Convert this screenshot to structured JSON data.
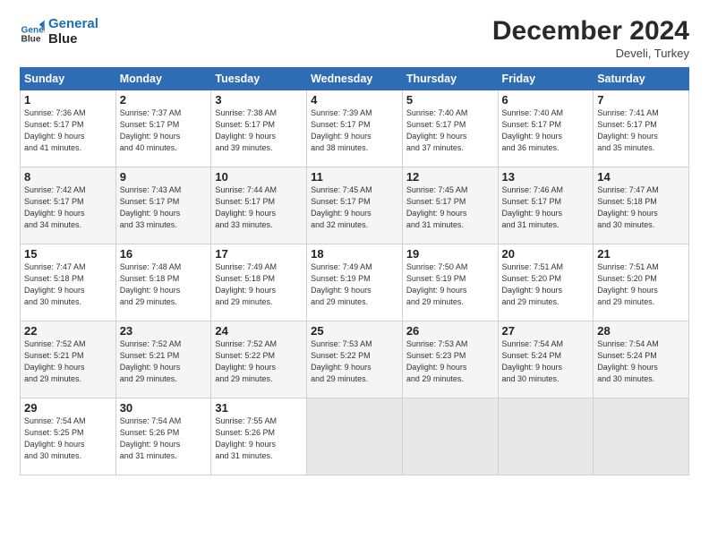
{
  "logo": {
    "line1": "General",
    "line2": "Blue"
  },
  "title": "December 2024",
  "location": "Develi, Turkey",
  "days_of_week": [
    "Sunday",
    "Monday",
    "Tuesday",
    "Wednesday",
    "Thursday",
    "Friday",
    "Saturday"
  ],
  "weeks": [
    [
      {
        "day": "1",
        "info": "Sunrise: 7:36 AM\nSunset: 5:17 PM\nDaylight: 9 hours\nand 41 minutes."
      },
      {
        "day": "2",
        "info": "Sunrise: 7:37 AM\nSunset: 5:17 PM\nDaylight: 9 hours\nand 40 minutes."
      },
      {
        "day": "3",
        "info": "Sunrise: 7:38 AM\nSunset: 5:17 PM\nDaylight: 9 hours\nand 39 minutes."
      },
      {
        "day": "4",
        "info": "Sunrise: 7:39 AM\nSunset: 5:17 PM\nDaylight: 9 hours\nand 38 minutes."
      },
      {
        "day": "5",
        "info": "Sunrise: 7:40 AM\nSunset: 5:17 PM\nDaylight: 9 hours\nand 37 minutes."
      },
      {
        "day": "6",
        "info": "Sunrise: 7:40 AM\nSunset: 5:17 PM\nDaylight: 9 hours\nand 36 minutes."
      },
      {
        "day": "7",
        "info": "Sunrise: 7:41 AM\nSunset: 5:17 PM\nDaylight: 9 hours\nand 35 minutes."
      }
    ],
    [
      {
        "day": "8",
        "info": "Sunrise: 7:42 AM\nSunset: 5:17 PM\nDaylight: 9 hours\nand 34 minutes."
      },
      {
        "day": "9",
        "info": "Sunrise: 7:43 AM\nSunset: 5:17 PM\nDaylight: 9 hours\nand 33 minutes."
      },
      {
        "day": "10",
        "info": "Sunrise: 7:44 AM\nSunset: 5:17 PM\nDaylight: 9 hours\nand 33 minutes."
      },
      {
        "day": "11",
        "info": "Sunrise: 7:45 AM\nSunset: 5:17 PM\nDaylight: 9 hours\nand 32 minutes."
      },
      {
        "day": "12",
        "info": "Sunrise: 7:45 AM\nSunset: 5:17 PM\nDaylight: 9 hours\nand 31 minutes."
      },
      {
        "day": "13",
        "info": "Sunrise: 7:46 AM\nSunset: 5:17 PM\nDaylight: 9 hours\nand 31 minutes."
      },
      {
        "day": "14",
        "info": "Sunrise: 7:47 AM\nSunset: 5:18 PM\nDaylight: 9 hours\nand 30 minutes."
      }
    ],
    [
      {
        "day": "15",
        "info": "Sunrise: 7:47 AM\nSunset: 5:18 PM\nDaylight: 9 hours\nand 30 minutes."
      },
      {
        "day": "16",
        "info": "Sunrise: 7:48 AM\nSunset: 5:18 PM\nDaylight: 9 hours\nand 29 minutes."
      },
      {
        "day": "17",
        "info": "Sunrise: 7:49 AM\nSunset: 5:18 PM\nDaylight: 9 hours\nand 29 minutes."
      },
      {
        "day": "18",
        "info": "Sunrise: 7:49 AM\nSunset: 5:19 PM\nDaylight: 9 hours\nand 29 minutes."
      },
      {
        "day": "19",
        "info": "Sunrise: 7:50 AM\nSunset: 5:19 PM\nDaylight: 9 hours\nand 29 minutes."
      },
      {
        "day": "20",
        "info": "Sunrise: 7:51 AM\nSunset: 5:20 PM\nDaylight: 9 hours\nand 29 minutes."
      },
      {
        "day": "21",
        "info": "Sunrise: 7:51 AM\nSunset: 5:20 PM\nDaylight: 9 hours\nand 29 minutes."
      }
    ],
    [
      {
        "day": "22",
        "info": "Sunrise: 7:52 AM\nSunset: 5:21 PM\nDaylight: 9 hours\nand 29 minutes."
      },
      {
        "day": "23",
        "info": "Sunrise: 7:52 AM\nSunset: 5:21 PM\nDaylight: 9 hours\nand 29 minutes."
      },
      {
        "day": "24",
        "info": "Sunrise: 7:52 AM\nSunset: 5:22 PM\nDaylight: 9 hours\nand 29 minutes."
      },
      {
        "day": "25",
        "info": "Sunrise: 7:53 AM\nSunset: 5:22 PM\nDaylight: 9 hours\nand 29 minutes."
      },
      {
        "day": "26",
        "info": "Sunrise: 7:53 AM\nSunset: 5:23 PM\nDaylight: 9 hours\nand 29 minutes."
      },
      {
        "day": "27",
        "info": "Sunrise: 7:54 AM\nSunset: 5:24 PM\nDaylight: 9 hours\nand 30 minutes."
      },
      {
        "day": "28",
        "info": "Sunrise: 7:54 AM\nSunset: 5:24 PM\nDaylight: 9 hours\nand 30 minutes."
      }
    ],
    [
      {
        "day": "29",
        "info": "Sunrise: 7:54 AM\nSunset: 5:25 PM\nDaylight: 9 hours\nand 30 minutes."
      },
      {
        "day": "30",
        "info": "Sunrise: 7:54 AM\nSunset: 5:26 PM\nDaylight: 9 hours\nand 31 minutes."
      },
      {
        "day": "31",
        "info": "Sunrise: 7:55 AM\nSunset: 5:26 PM\nDaylight: 9 hours\nand 31 minutes."
      },
      {
        "day": "",
        "info": ""
      },
      {
        "day": "",
        "info": ""
      },
      {
        "day": "",
        "info": ""
      },
      {
        "day": "",
        "info": ""
      }
    ]
  ]
}
